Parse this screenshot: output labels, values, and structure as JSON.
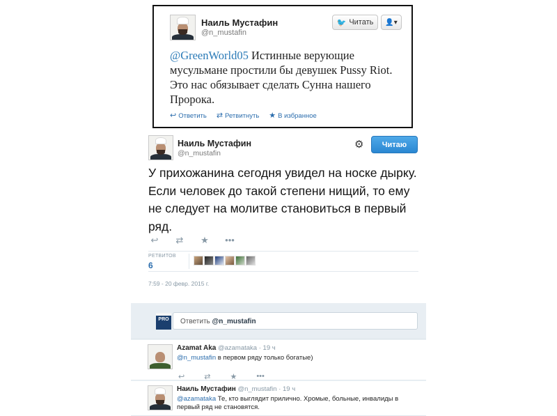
{
  "card1": {
    "name": "Наиль Мустафин",
    "handle": "@n_mustafin",
    "follow_label": "Читать",
    "user_menu_label": "▾",
    "mention": "@GreenWorld05",
    "text": " Истинные верующие мусульмане простили бы девушек Pussy Riot. Это нас обязывает сделать Сунна нашего Пророка.",
    "actions": [
      {
        "icon": "reply-icon",
        "glyph": "↩",
        "label": "Ответить"
      },
      {
        "icon": "retweet-icon",
        "glyph": "⇄",
        "label": "Ретвитнуть"
      },
      {
        "icon": "star-icon",
        "glyph": "★",
        "label": "В избранное"
      }
    ]
  },
  "main": {
    "name": "Наиль Мустафин",
    "handle": "@n_mustafin",
    "following_label": "Читаю",
    "text": "У прихожанина сегодня увидел на носке дырку. Если человек до такой степени нищий, то ему не следует на молитве становиться в первый ряд.",
    "retweets_label": "РЕТВИТОВ",
    "retweets_count": "6",
    "date": "7:59 - 20 февр. 2015 г."
  },
  "compose": {
    "prefix": "Ответить ",
    "mention": "@n_mustafin",
    "logo_text": "PRO"
  },
  "replies": [
    {
      "name": "Azamat Aka",
      "handle": "@azamataka",
      "time": "· 19 ч",
      "mention": "@n_mustafin",
      "text": " в первом ряду только богатые)"
    },
    {
      "name": "Наиль Мустафин",
      "handle": "@n_mustafin",
      "time": "· 19 ч",
      "mention": "@azamataka",
      "text": " Те, кто выглядит прилично. Хромые, больные, инвалиды в первый ряд не становятся."
    }
  ],
  "colors": {
    "link": "#2b6dad",
    "follow_button": "#2a87d2",
    "muted": "#8899a6"
  }
}
